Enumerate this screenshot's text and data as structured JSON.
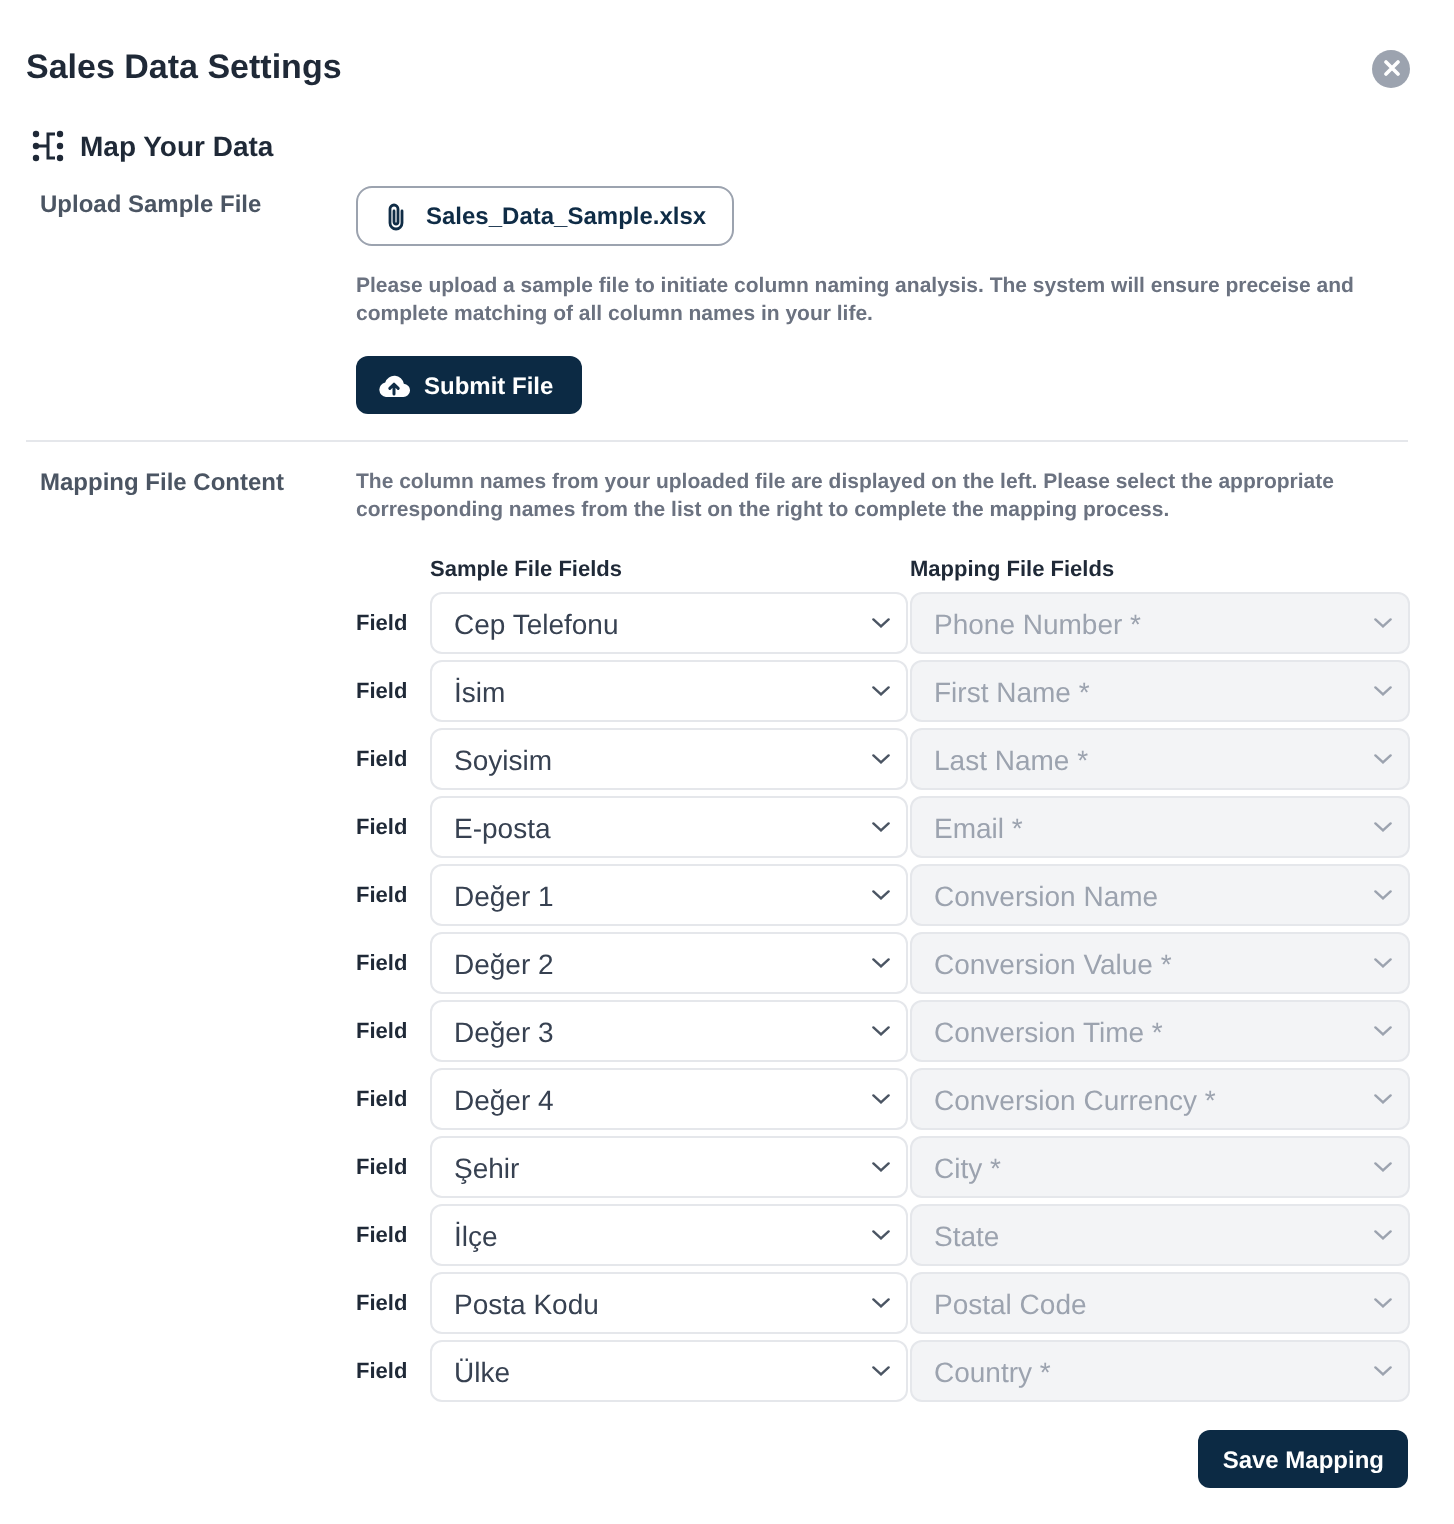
{
  "dialog": {
    "title": "Sales Data Settings"
  },
  "section": {
    "title": "Map Your Data"
  },
  "upload": {
    "label": "Upload Sample File",
    "file_name": "Sales_Data_Sample.xlsx",
    "description": "Please upload a sample file to initiate column naming analysis. The system will ensure preceise and complete matching of all column names in your life.",
    "submit_button": "Submit File"
  },
  "mapping": {
    "label": "Mapping File Content",
    "description": "The column names from your uploaded file are displayed on the left. Please select the appropriate corresponding names from the list on the right to complete the mapping process.",
    "columns": [
      "Sample File Fields",
      "Mapping File Fields"
    ],
    "rows": [
      {
        "label": "Field",
        "sample_value": "Cep Telefonu",
        "sample_disabled": false,
        "mapping_value": "Phone Number *",
        "mapping_disabled": true
      },
      {
        "label": "Field",
        "sample_value": "İsim",
        "sample_disabled": false,
        "mapping_value": "First Name *",
        "mapping_disabled": true
      },
      {
        "label": "Field",
        "sample_value": "Soyisim",
        "sample_disabled": false,
        "mapping_value": "Last Name *",
        "mapping_disabled": true
      },
      {
        "label": "Field",
        "sample_value": "E-posta",
        "sample_disabled": false,
        "mapping_value": "Email *",
        "mapping_disabled": true
      },
      {
        "label": "Field",
        "sample_value": "Değer 1",
        "sample_disabled": false,
        "mapping_value": "Conversion Name",
        "mapping_disabled": true
      },
      {
        "label": "Field",
        "sample_value": "Değer 2",
        "sample_disabled": false,
        "mapping_value": "Conversion Value *",
        "mapping_disabled": true
      },
      {
        "label": "Field",
        "sample_value": "Değer 3",
        "sample_disabled": false,
        "mapping_value": "Conversion Time *",
        "mapping_disabled": true
      },
      {
        "label": "Field",
        "sample_value": "Değer 4",
        "sample_disabled": false,
        "mapping_value": "Conversion Currency *",
        "mapping_disabled": true
      },
      {
        "label": "Field",
        "sample_value": "Şehir",
        "sample_disabled": false,
        "mapping_value": "City *",
        "mapping_disabled": true
      },
      {
        "label": "Field",
        "sample_value": "İlçe",
        "sample_disabled": false,
        "mapping_value": "State",
        "mapping_disabled": true
      },
      {
        "label": "Field",
        "sample_value": "Posta Kodu",
        "sample_disabled": false,
        "mapping_value": "Postal Code",
        "mapping_disabled": true
      },
      {
        "label": "Field",
        "sample_value": "Ülke",
        "sample_disabled": false,
        "mapping_value": "Country *",
        "mapping_disabled": true
      }
    ]
  },
  "save_button": "Save Mapping"
}
